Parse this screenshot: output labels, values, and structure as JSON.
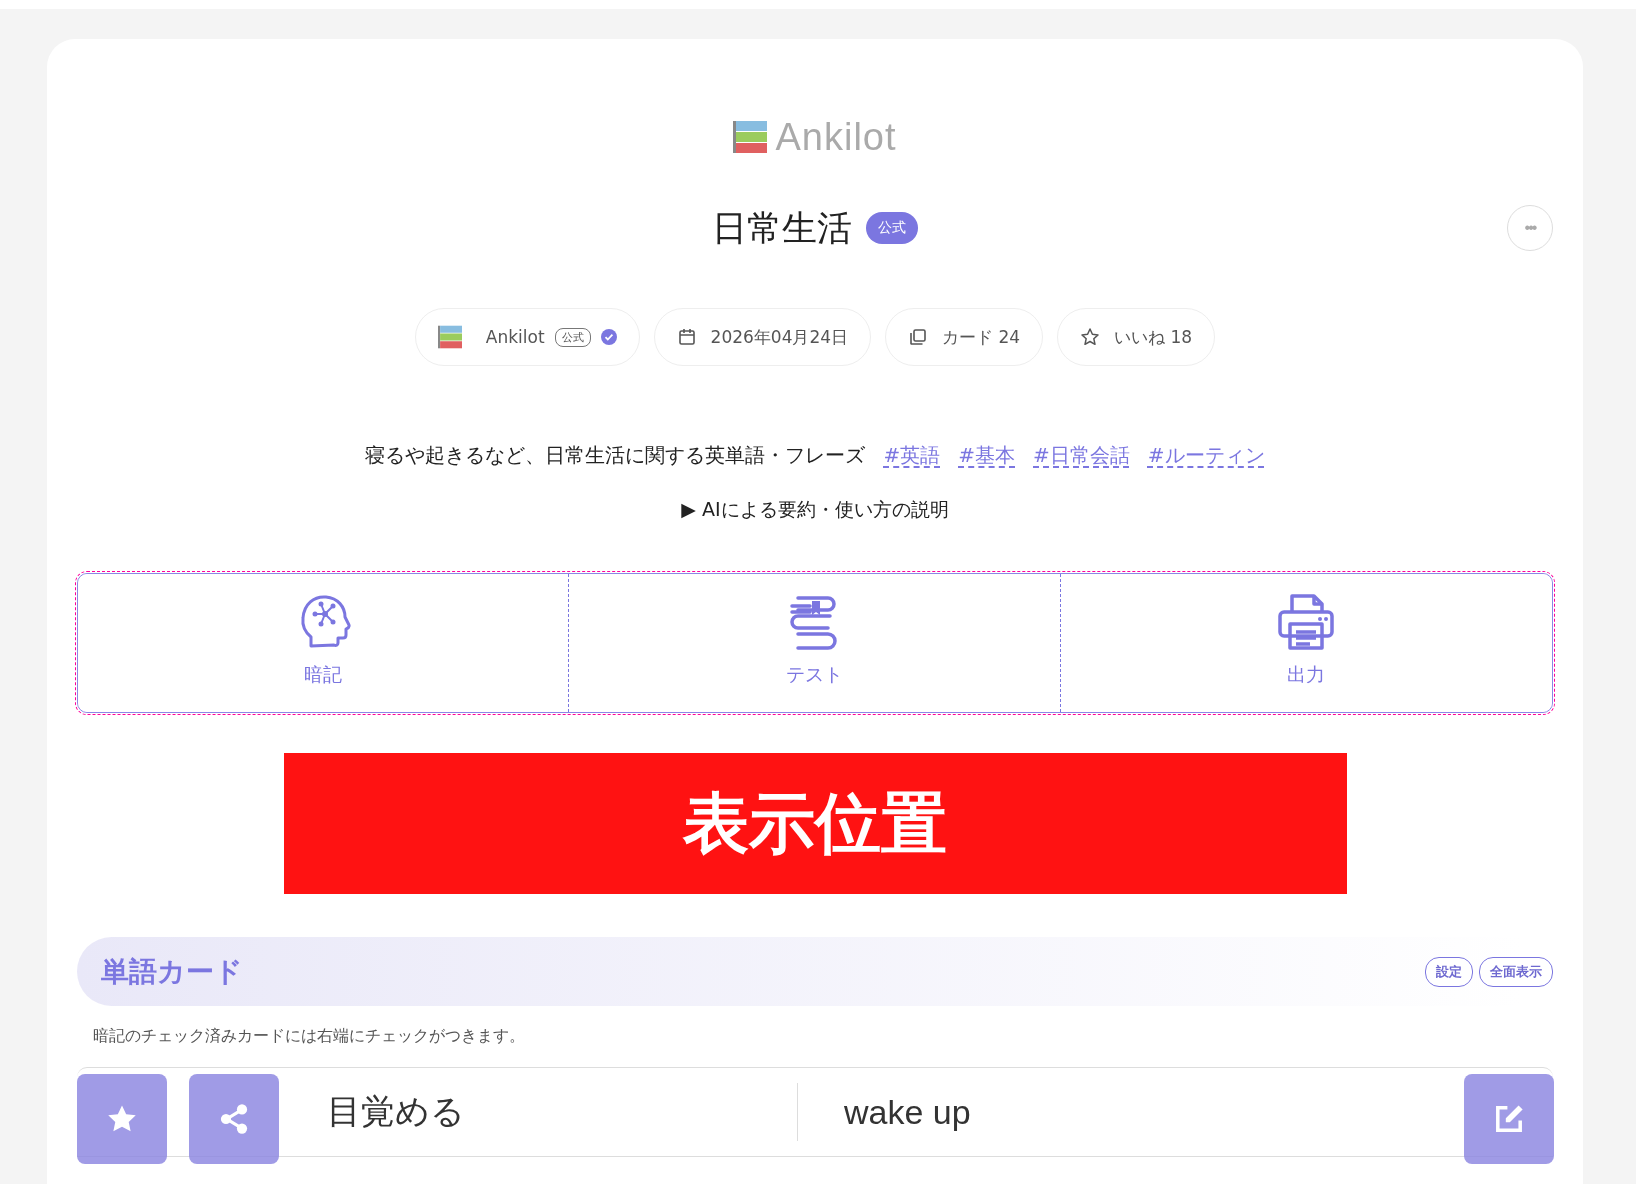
{
  "logo": {
    "text": "Ankilot"
  },
  "title": {
    "text": "日常生活",
    "badge": "公式"
  },
  "more_button": {
    "label": "•••"
  },
  "meta": [
    {
      "kind": "author",
      "text": "Ankilot",
      "badge": "公式",
      "verified": true
    },
    {
      "kind": "date",
      "text": "2026年04月24日"
    },
    {
      "kind": "cards",
      "text": "カード 24"
    },
    {
      "kind": "likes",
      "text": "いいね 18"
    }
  ],
  "description": {
    "text": "寝るや起きるなど、日常生活に関する英単語・フレーズ",
    "tags": [
      "#英語",
      "#基本",
      "#日常会話",
      "#ルーティン"
    ]
  },
  "ai_summary": {
    "label": "▶ AIによる要約・使い方の説明",
    "expanded": false
  },
  "actions": [
    {
      "kind": "memorize",
      "label": "暗記"
    },
    {
      "kind": "test",
      "label": "テスト"
    },
    {
      "kind": "print",
      "label": "出力"
    }
  ],
  "ad_banner": {
    "text": "表示位置"
  },
  "section": {
    "title": "単語カード",
    "buttons": [
      "設定",
      "全面表示"
    ],
    "note": "暗記のチェック済みカードには右端にチェックがつきます。"
  },
  "cards": [
    {
      "front": "目覚める",
      "back": "wake up"
    }
  ],
  "floating_buttons": [
    {
      "kind": "star"
    },
    {
      "kind": "share"
    },
    {
      "kind": "edit"
    }
  ]
}
